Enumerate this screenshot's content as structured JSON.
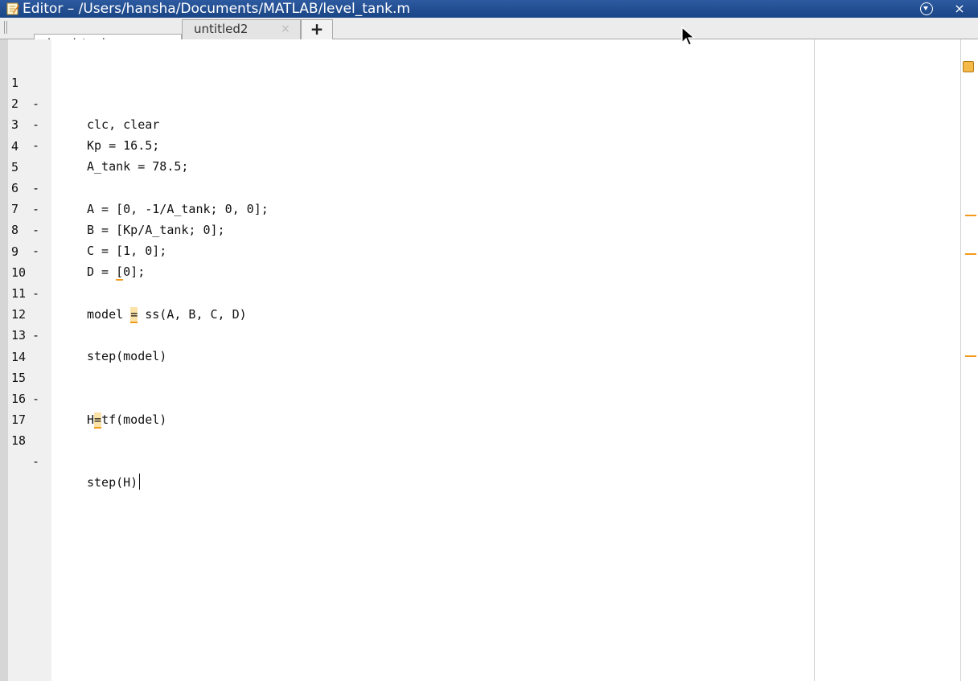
{
  "window": {
    "title": "Editor – /Users/hansha/Documents/MATLAB/level_tank.m"
  },
  "tabs": [
    {
      "label": "level_tank.m",
      "close": "×",
      "active": true
    },
    {
      "label": "untitled2",
      "close": "×",
      "active": false
    }
  ],
  "add_tab_label": "+",
  "close_label": "×",
  "icons": {
    "doc": "editor-doc-icon",
    "menu": "chevron-down-circle-icon",
    "close": "close-icon",
    "cursor": "mouse-pointer-icon"
  },
  "colors": {
    "titlebar": "#1a4585",
    "highlight": "#fbe3a8",
    "warning": "#f39a1a"
  },
  "lines": [
    {
      "n": "1",
      "marker": "-",
      "code": "clc, clear"
    },
    {
      "n": "2",
      "marker": "-",
      "code": "Kp = 16.5;"
    },
    {
      "n": "3",
      "marker": "-",
      "code": "A_tank = 78.5;"
    },
    {
      "n": "4",
      "marker": "",
      "code": ""
    },
    {
      "n": "5",
      "marker": "-",
      "code": "A = [0, -1/A_tank; 0, 0];"
    },
    {
      "n": "6",
      "marker": "-",
      "code": "B = [Kp/A_tank; 0];"
    },
    {
      "n": "7",
      "marker": "-",
      "code": "C = [1, 0];"
    },
    {
      "n": "8",
      "marker": "-",
      "code": "D = [0];"
    },
    {
      "n": "9",
      "marker": "",
      "code": ""
    },
    {
      "n": "10",
      "marker": "-",
      "code": "model = ss(A, B, C, D)"
    },
    {
      "n": "11",
      "marker": "",
      "code": ""
    },
    {
      "n": "12",
      "marker": "-",
      "code": "step(model)"
    },
    {
      "n": "13",
      "marker": "",
      "code": ""
    },
    {
      "n": "14",
      "marker": "",
      "code": ""
    },
    {
      "n": "15",
      "marker": "-",
      "code": "H=tf(model)"
    },
    {
      "n": "16",
      "marker": "",
      "code": ""
    },
    {
      "n": "17",
      "marker": "",
      "code": ""
    },
    {
      "n": "18",
      "marker": "-",
      "code": "step(H)"
    }
  ],
  "code_parts": {
    "l8a": "D = ",
    "l8b": "[",
    "l8c": "0];",
    "l10a": "model ",
    "l10b": "=",
    "l10c": " ss(A, B, C, D)",
    "l15a": "H",
    "l15b": "=",
    "l15c": "tf(model)"
  }
}
